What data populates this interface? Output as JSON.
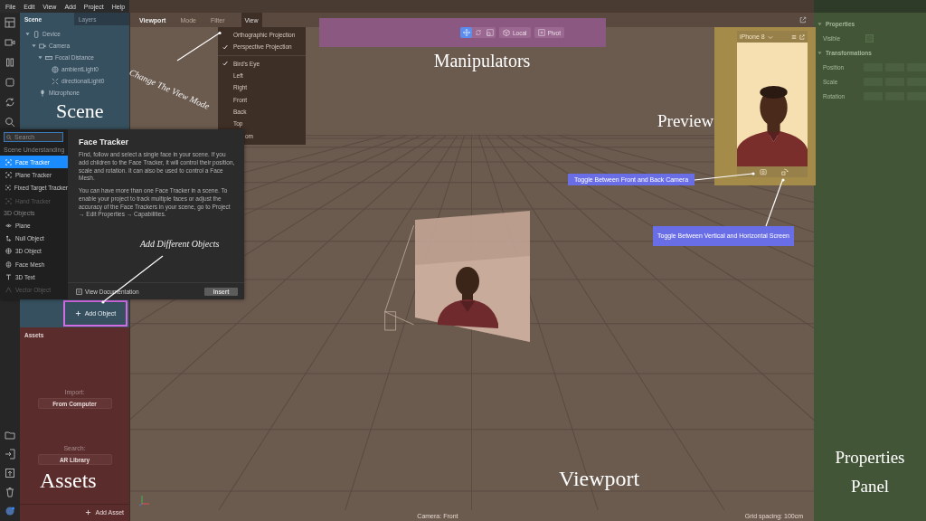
{
  "menu_bar": [
    "File",
    "Edit",
    "View",
    "Add",
    "Project",
    "Help"
  ],
  "scene_panel": {
    "tabs": [
      {
        "label": "Scene",
        "selected": true
      },
      {
        "label": "Layers",
        "selected": false
      }
    ],
    "tree": [
      {
        "label": "Device",
        "kind": "device",
        "expanded": true,
        "children": [
          {
            "label": "Camera",
            "kind": "camera",
            "expanded": true,
            "children": [
              {
                "label": "Focal Distance",
                "kind": "focal",
                "expanded": true,
                "children": [
                  {
                    "label": "ambientLight0",
                    "kind": "ambient"
                  },
                  {
                    "label": "directionalLight0",
                    "kind": "directional"
                  }
                ]
              }
            ]
          },
          {
            "label": "Microphone",
            "kind": "mic"
          }
        ]
      }
    ],
    "add_button": "Add Object"
  },
  "object_picker": {
    "search": {
      "placeholder": "Search"
    },
    "sections": [
      {
        "title": "Scene Understanding",
        "items": [
          {
            "label": "Face Tracker",
            "kind": "tracker",
            "selected": true,
            "disabled": false
          },
          {
            "label": "Plane Tracker",
            "kind": "tracker",
            "selected": false,
            "disabled": false
          },
          {
            "label": "Fixed Target Tracker",
            "kind": "tracker",
            "selected": false,
            "disabled": false
          },
          {
            "label": "Hand Tracker",
            "kind": "tracker",
            "selected": false,
            "disabled": true
          }
        ]
      },
      {
        "title": "3D Objects",
        "items": [
          {
            "label": "Plane",
            "kind": "plane",
            "selected": false,
            "disabled": false
          },
          {
            "label": "Null Object",
            "kind": "null",
            "selected": false,
            "disabled": false
          },
          {
            "label": "3D Object",
            "kind": "object",
            "selected": false,
            "disabled": false
          },
          {
            "label": "Face Mesh",
            "kind": "mesh",
            "selected": false,
            "disabled": false
          },
          {
            "label": "3D Text",
            "kind": "text",
            "selected": false,
            "disabled": false
          },
          {
            "label": "Vector Object",
            "kind": "vector",
            "selected": false,
            "disabled": true
          }
        ]
      }
    ],
    "detail": {
      "title": "Face Tracker",
      "paragraphs": [
        "Find, follow and select a single face in your scene. If you add children to the Face Tracker, it will control their position, scale and rotation. It can also be used to control a Face Mesh.",
        "You can have more than one Face Tracker in a scene. To enable your project to track multiple faces or adjust the accuracy of the Face Trackers in your scene, go to Project → Edit Properties → Capabilities."
      ],
      "link": "View Documentation",
      "button": "Insert"
    }
  },
  "viewport": {
    "tabs": [
      {
        "label": "Viewport",
        "selected": true,
        "open": false
      },
      {
        "label": "Mode",
        "selected": false,
        "open": false
      },
      {
        "label": "Filter",
        "selected": false,
        "open": false
      },
      {
        "label": "View",
        "selected": false,
        "open": true
      }
    ],
    "view_menu": [
      [
        {
          "label": "Orthographic Projection",
          "kind": "item",
          "checked": false
        },
        {
          "label": "Perspective Projection",
          "kind": "item",
          "checked": true
        }
      ],
      [
        {
          "label": "Bird's Eye",
          "kind": "item",
          "checked": true
        },
        {
          "label": "Left",
          "kind": "item",
          "checked": false
        },
        {
          "label": "Right",
          "kind": "item",
          "checked": false
        },
        {
          "label": "Front",
          "kind": "item",
          "checked": false
        },
        {
          "label": "Back",
          "kind": "item",
          "checked": false
        },
        {
          "label": "Top",
          "kind": "item",
          "checked": false
        },
        {
          "label": "om",
          "kind": "cut",
          "checked": false
        }
      ]
    ],
    "status": {
      "camera": "Camera: Front",
      "grid": "Grid spacing: 100cm"
    }
  },
  "manipulators": {
    "tools": [
      {
        "kind": "move",
        "selected": true
      },
      {
        "kind": "rotate",
        "selected": false
      },
      {
        "kind": "scale",
        "selected": false
      }
    ],
    "buttons": [
      {
        "kind": "local",
        "label": "Local"
      },
      {
        "kind": "pivot",
        "label": "Pivot"
      }
    ]
  },
  "preview": {
    "device": "iPhone 8"
  },
  "properties": {
    "sections": [
      {
        "title": "Properties",
        "expanded": true,
        "rows": [
          {
            "label": "Visible",
            "kind": "checkbox",
            "checked": false
          }
        ]
      },
      {
        "title": "Transformations",
        "expanded": true,
        "rows": [
          {
            "label": "Position",
            "kind": "vector"
          },
          {
            "label": "Scale",
            "kind": "vector"
          },
          {
            "label": "Rotation",
            "kind": "vector"
          }
        ]
      }
    ]
  },
  "assets": {
    "title": "Assets",
    "import_label": "Import:",
    "import_button": "From Computer",
    "search_label": "Search:",
    "search_button": "AR Library",
    "add_button": "Add Asset"
  },
  "annotations": [
    {
      "text": "Scene",
      "kind": "heading"
    },
    {
      "text": "Manipulators",
      "kind": "heading"
    },
    {
      "text": "Preview",
      "kind": "heading"
    },
    {
      "text": "Assets",
      "kind": "heading"
    },
    {
      "text": "Viewport",
      "kind": "heading"
    },
    {
      "text": "Properties Panel",
      "kind": "heading"
    },
    {
      "text": "Change The View Mode",
      "kind": "note"
    },
    {
      "text": "Add Different Objects",
      "kind": "note"
    },
    {
      "text": "Toggle Between Front and Back Camera",
      "kind": "tag"
    },
    {
      "text": "Toggle Between Vertical and Horizontal Screen",
      "kind": "tag"
    }
  ]
}
